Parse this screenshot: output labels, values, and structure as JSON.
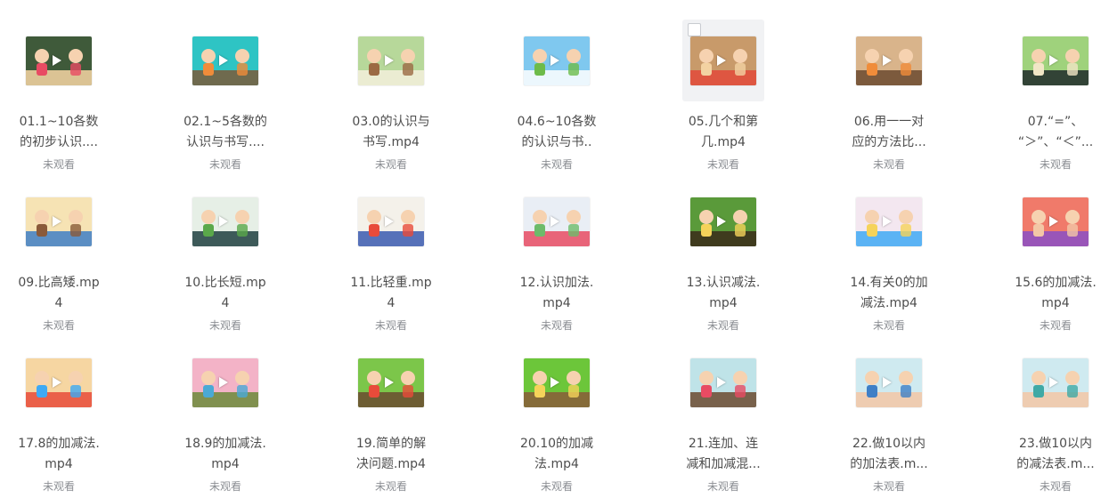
{
  "files": [
    {
      "line1": "01.1~10各数",
      "line2": "的初步认识....",
      "status": "未观看",
      "palette": [
        "#3f5a3a",
        "#e84b63",
        "#f7d6a5"
      ]
    },
    {
      "line1": "02.1~5各数的",
      "line2": "认识与书写....",
      "status": "未观看",
      "palette": [
        "#2ec4c4",
        "#f08c3a",
        "#7a5b3a"
      ]
    },
    {
      "line1": "03.0的认识与",
      "line2": "书写.mp4",
      "status": "未观看",
      "palette": [
        "#b7d89a",
        "#9b6a43",
        "#f5f0dc"
      ]
    },
    {
      "line1": "04.6~10各数",
      "line2": "的认识与书..",
      "status": "未观看",
      "palette": [
        "#7fc8ef",
        "#6dbb4a",
        "#ffffff"
      ]
    },
    {
      "line1": "05.几个和第",
      "line2": "几.mp4",
      "status": "未观看",
      "palette": [
        "#c89a6a",
        "#f3d2a2",
        "#e24a3a"
      ]
    },
    {
      "line1": "06.用一一对",
      "line2": "应的方法比...",
      "status": "未观看",
      "palette": [
        "#d9b48b",
        "#f08c3a",
        "#6b4a2f"
      ]
    },
    {
      "line1": "07.“=”、",
      "line2": "“＞”、“＜”...",
      "status": "未观看",
      "palette": [
        "#9fd27c",
        "#f1e6c6",
        "#1f2a2a"
      ]
    },
    {
      "line1": "09.比高矮.mp",
      "line2": "4",
      "status": "未观看",
      "palette": [
        "#f6e3b4",
        "#8a5a3a",
        "#3f7fc6"
      ]
    },
    {
      "line1": "10.比长短.mp",
      "line2": "4",
      "status": "未观看",
      "palette": [
        "#e6efe6",
        "#5aa84a",
        "#1f3f3f"
      ]
    },
    {
      "line1": "11.比轻重.mp",
      "line2": "4",
      "status": "未观看",
      "palette": [
        "#f4f1ea",
        "#e84b3a",
        "#3a5ab0"
      ]
    },
    {
      "line1": "12.认识加法.",
      "line2": "mp4",
      "status": "未观看",
      "palette": [
        "#e9eef5",
        "#6dbb6a",
        "#e84b63"
      ]
    },
    {
      "line1": "13.认识减法.",
      "line2": "mp4",
      "status": "未观看",
      "palette": [
        "#5a9a3a",
        "#f5d35a",
        "#3b2a1a"
      ]
    },
    {
      "line1": "14.有关0的加",
      "line2": "减法.mp4",
      "status": "未观看",
      "palette": [
        "#f3e7f0",
        "#f5d35a",
        "#3fa9f5"
      ]
    },
    {
      "line1": "15.6的加减法.",
      "line2": "mp4",
      "status": "未观看",
      "palette": [
        "#f07a6a",
        "#f3c7a6",
        "#8a4fc6"
      ]
    },
    {
      "line1": "17.8的加减法.",
      "line2": "mp4",
      "status": "未观看",
      "palette": [
        "#f6d6a2",
        "#3fa9f5",
        "#e84b3a"
      ]
    },
    {
      "line1": "18.9的加减法.",
      "line2": "mp4",
      "status": "未观看",
      "palette": [
        "#f3b3c7",
        "#4aa9d5",
        "#6b8a3a"
      ]
    },
    {
      "line1": "19.简单的解",
      "line2": "决问题.mp4",
      "status": "未观看",
      "palette": [
        "#7cc64a",
        "#e84b3a",
        "#6b4a2f"
      ]
    },
    {
      "line1": "20.10的加减",
      "line2": "法.mp4",
      "status": "未观看",
      "palette": [
        "#6cc63a",
        "#f5d35a",
        "#8a5a3a"
      ]
    },
    {
      "line1": "21.连加、连",
      "line2": "减和加减混...",
      "status": "未观看",
      "palette": [
        "#bfe3e8",
        "#e84b63",
        "#6b4a2f"
      ]
    },
    {
      "line1": "22.做10以内",
      "line2": "的加法表.m...",
      "status": "未观看",
      "palette": [
        "#cfeaf0",
        "#3f7fc6",
        "#f3c7a6"
      ]
    },
    {
      "line1": "23.做10以内",
      "line2": "的减法表.m...",
      "status": "未观看",
      "palette": [
        "#cfeaf0",
        "#3fa9a5",
        "#f3c7a6"
      ]
    }
  ]
}
